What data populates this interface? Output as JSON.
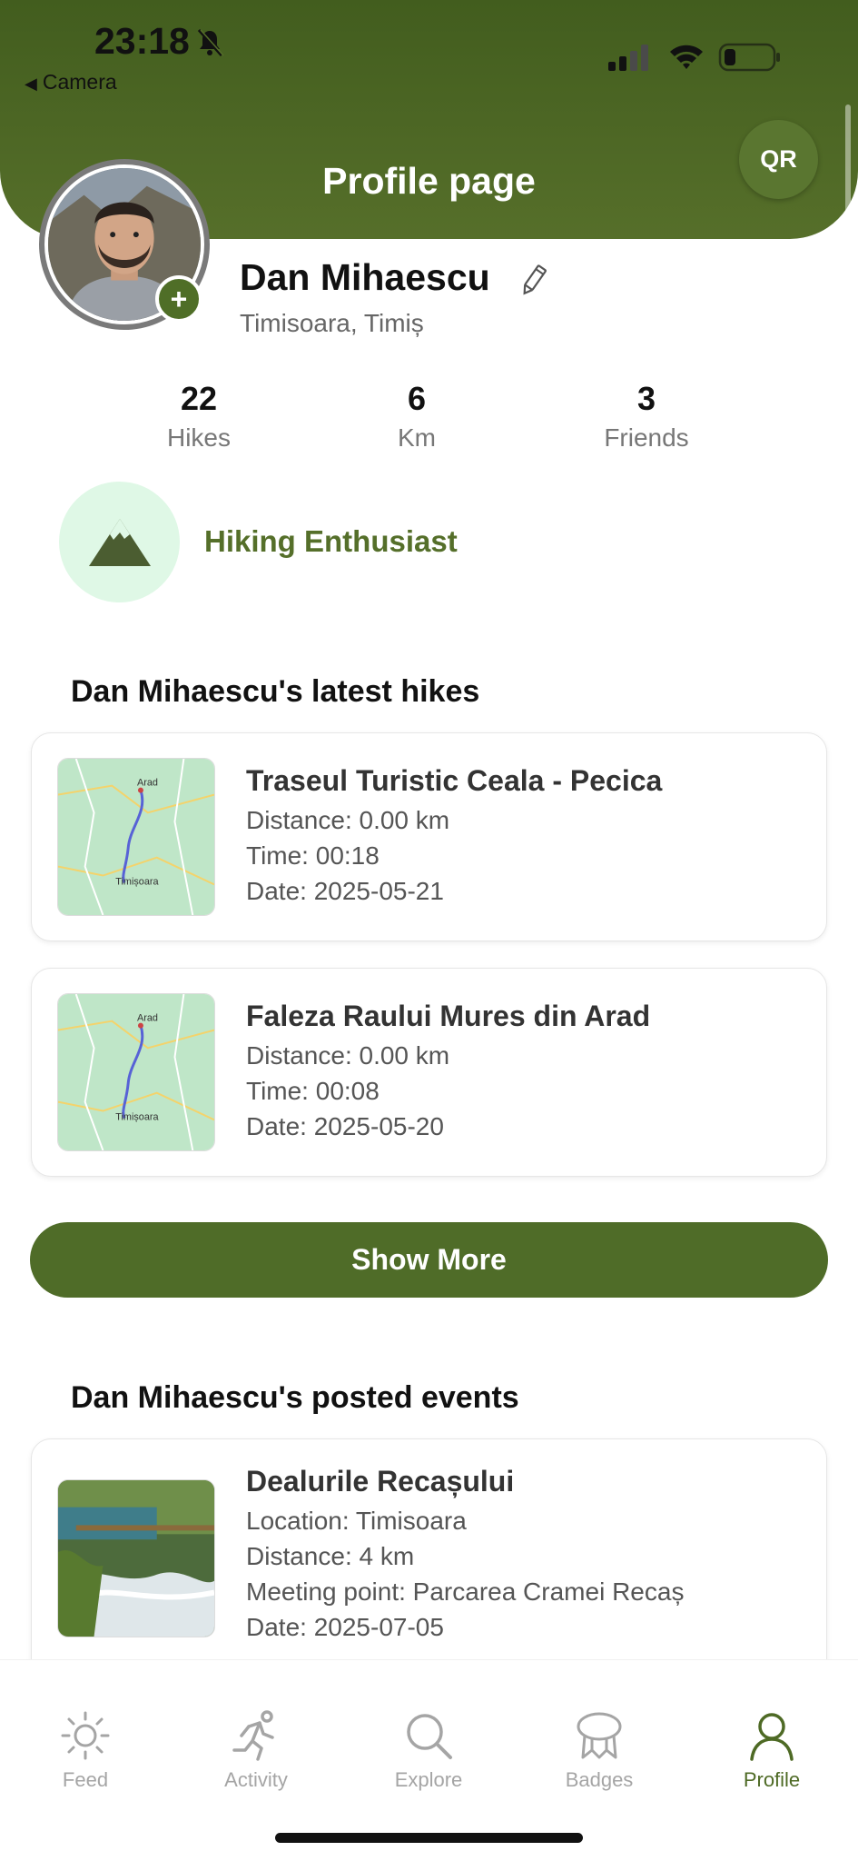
{
  "status_bar": {
    "time": "23:18",
    "back_label": "Camera"
  },
  "header": {
    "title": "Profile page",
    "qr_label": "QR"
  },
  "profile": {
    "name": "Dan Mihaescu",
    "location": "Timisoara, Timiș"
  },
  "stats": [
    {
      "value": "22",
      "label": "Hikes"
    },
    {
      "value": "6",
      "label": "Km"
    },
    {
      "value": "3",
      "label": "Friends"
    }
  ],
  "badge": {
    "title": "Hiking Enthusiast",
    "icon": "mountain-icon"
  },
  "hikes_section": {
    "title": "Dan Mihaescu's latest hikes",
    "items": [
      {
        "name": "Traseul Turistic Ceala - Pecica",
        "distance": "Distance: 0.00 km",
        "time": "Time: 00:18",
        "date": "Date: 2025-05-21"
      },
      {
        "name": "Faleza Raului Mures din Arad",
        "distance": "Distance: 0.00 km",
        "time": "Time: 00:08",
        "date": "Date: 2025-05-20"
      }
    ],
    "show_more_label": "Show More"
  },
  "map_labels": {
    "arad": "Arad",
    "timisoara": "Timișoara"
  },
  "events_section": {
    "title": "Dan Mihaescu's posted events",
    "items": [
      {
        "name": "Dealurile Recașului",
        "location": "Location: Timisoara",
        "distance": "Distance: 4 km",
        "meeting_point": "Meeting point: Parcarea Cramei Recaș",
        "date": "Date: 2025-07-05"
      }
    ]
  },
  "tabbar": {
    "items": [
      {
        "label": "Feed",
        "icon": "sun-icon"
      },
      {
        "label": "Activity",
        "icon": "runner-icon"
      },
      {
        "label": "Explore",
        "icon": "search-icon"
      },
      {
        "label": "Badges",
        "icon": "badge-icon"
      },
      {
        "label": "Profile",
        "icon": "user-icon"
      }
    ],
    "active": "Profile"
  },
  "colors": {
    "primary": "#4f6c28",
    "badge_bg": "#dff8e6",
    "badge_text": "#556f2a",
    "tab_inactive": "#a5a5a5"
  }
}
